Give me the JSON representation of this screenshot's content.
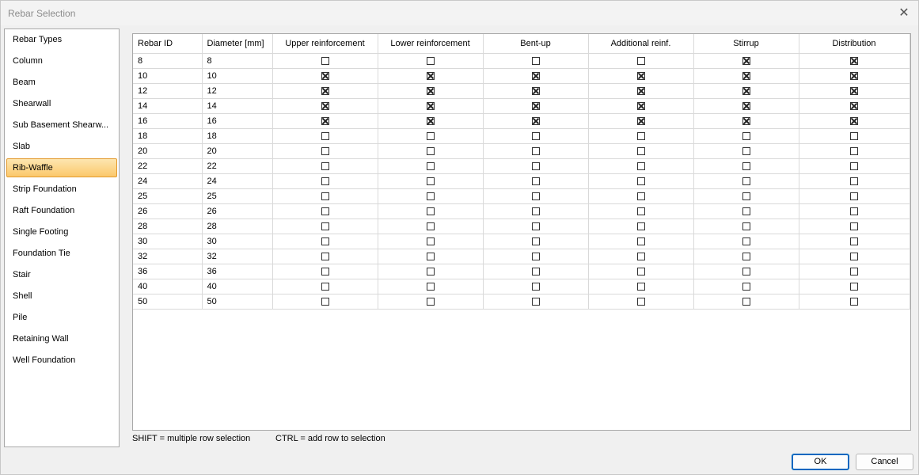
{
  "window": {
    "title": "Rebar Selection",
    "close_icon": "close-icon"
  },
  "sidebar": {
    "items": [
      {
        "label": "Rebar Types"
      },
      {
        "label": "Column"
      },
      {
        "label": "Beam"
      },
      {
        "label": "Shearwall"
      },
      {
        "label": "Sub Basement Shearw..."
      },
      {
        "label": "Slab"
      },
      {
        "label": "Rib-Waffle",
        "selected": true
      },
      {
        "label": "Strip Foundation"
      },
      {
        "label": "Raft Foundation"
      },
      {
        "label": "Single Footing"
      },
      {
        "label": "Foundation Tie"
      },
      {
        "label": "Stair"
      },
      {
        "label": "Shell"
      },
      {
        "label": "Pile"
      },
      {
        "label": "Retaining Wall"
      },
      {
        "label": "Well Foundation"
      }
    ]
  },
  "table": {
    "columns": [
      "Rebar ID",
      "Diameter [mm]",
      "Upper reinforcement",
      "Lower reinforcement",
      "Bent-up",
      "Additional reinf.",
      "Stirrup",
      "Distribution"
    ],
    "rows": [
      {
        "id": "8",
        "diameter": "8",
        "checks": [
          false,
          false,
          false,
          false,
          true,
          true
        ]
      },
      {
        "id": "10",
        "diameter": "10",
        "checks": [
          true,
          true,
          true,
          true,
          true,
          true
        ]
      },
      {
        "id": "12",
        "diameter": "12",
        "checks": [
          true,
          true,
          true,
          true,
          true,
          true
        ]
      },
      {
        "id": "14",
        "diameter": "14",
        "checks": [
          true,
          true,
          true,
          true,
          true,
          true
        ]
      },
      {
        "id": "16",
        "diameter": "16",
        "checks": [
          true,
          true,
          true,
          true,
          true,
          true
        ]
      },
      {
        "id": "18",
        "diameter": "18",
        "checks": [
          false,
          false,
          false,
          false,
          false,
          false
        ]
      },
      {
        "id": "20",
        "diameter": "20",
        "checks": [
          false,
          false,
          false,
          false,
          false,
          false
        ]
      },
      {
        "id": "22",
        "diameter": "22",
        "checks": [
          false,
          false,
          false,
          false,
          false,
          false
        ]
      },
      {
        "id": "24",
        "diameter": "24",
        "checks": [
          false,
          false,
          false,
          false,
          false,
          false
        ]
      },
      {
        "id": "25",
        "diameter": "25",
        "checks": [
          false,
          false,
          false,
          false,
          false,
          false
        ]
      },
      {
        "id": "26",
        "diameter": "26",
        "checks": [
          false,
          false,
          false,
          false,
          false,
          false
        ]
      },
      {
        "id": "28",
        "diameter": "28",
        "checks": [
          false,
          false,
          false,
          false,
          false,
          false
        ]
      },
      {
        "id": "30",
        "diameter": "30",
        "checks": [
          false,
          false,
          false,
          false,
          false,
          false
        ]
      },
      {
        "id": "32",
        "diameter": "32",
        "checks": [
          false,
          false,
          false,
          false,
          false,
          false
        ]
      },
      {
        "id": "36",
        "diameter": "36",
        "checks": [
          false,
          false,
          false,
          false,
          false,
          false
        ]
      },
      {
        "id": "40",
        "diameter": "40",
        "checks": [
          false,
          false,
          false,
          false,
          false,
          false
        ]
      },
      {
        "id": "50",
        "diameter": "50",
        "checks": [
          false,
          false,
          false,
          false,
          false,
          false
        ]
      }
    ]
  },
  "hints": {
    "shift": "SHIFT = multiple row selection",
    "ctrl": "CTRL = add row to selection"
  },
  "buttons": {
    "ok": "OK",
    "cancel": "Cancel"
  },
  "colors": {
    "selected_bg": "#fbc86b",
    "selected_border": "#e39a2d",
    "default_button_border": "#0067c0"
  }
}
